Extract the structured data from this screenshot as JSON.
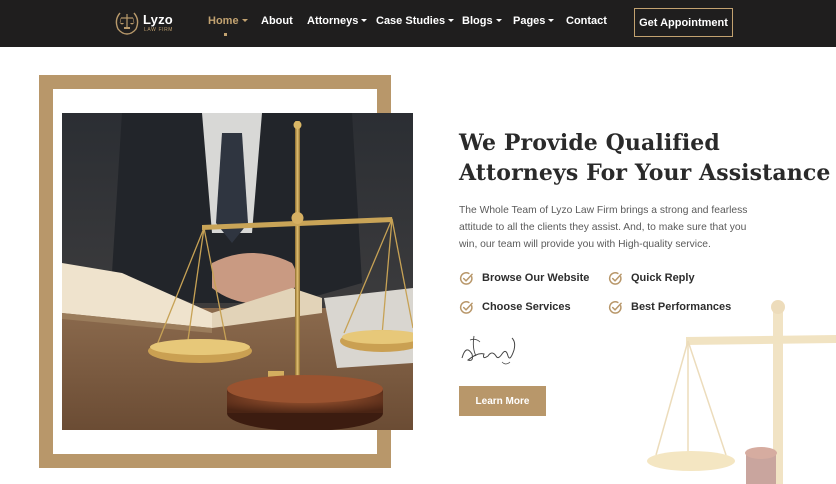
{
  "brand": {
    "name": "Lyzo",
    "tagline": "LAW FIRM",
    "accent_color": "#c2a270",
    "dark_color": "#1f1e1e",
    "emblem_icon": "scales-laurel-logo"
  },
  "nav": {
    "items": [
      {
        "label": "Home",
        "has_dropdown": true,
        "active": true
      },
      {
        "label": "About",
        "has_dropdown": false,
        "active": false
      },
      {
        "label": "Attorneys",
        "has_dropdown": true,
        "active": false
      },
      {
        "label": "Case Studies",
        "has_dropdown": true,
        "active": false
      },
      {
        "label": "Blogs",
        "has_dropdown": true,
        "active": false
      },
      {
        "label": "Pages",
        "has_dropdown": true,
        "active": false
      },
      {
        "label": "Contact",
        "has_dropdown": false,
        "active": false
      }
    ],
    "cta_label": "Get Appointment"
  },
  "about": {
    "heading_line1": "We Provide Qualified",
    "heading_line2": "Attorneys For Your Assistance",
    "description": "The Whole Team of Lyzo Law Firm brings a strong and fearless attitude to all the clients they assist. And, to make sure that you win, our team will provide you with High-quality service.",
    "features": [
      {
        "label": "Browse Our Website",
        "icon": "check-circle-icon"
      },
      {
        "label": "Quick Reply",
        "icon": "check-circle-icon"
      },
      {
        "label": "Choose Services",
        "icon": "check-circle-icon"
      },
      {
        "label": "Best Performances",
        "icon": "check-circle-icon"
      }
    ],
    "button_label": "Learn More",
    "photo_subject": "scales-of-justice-photo"
  }
}
